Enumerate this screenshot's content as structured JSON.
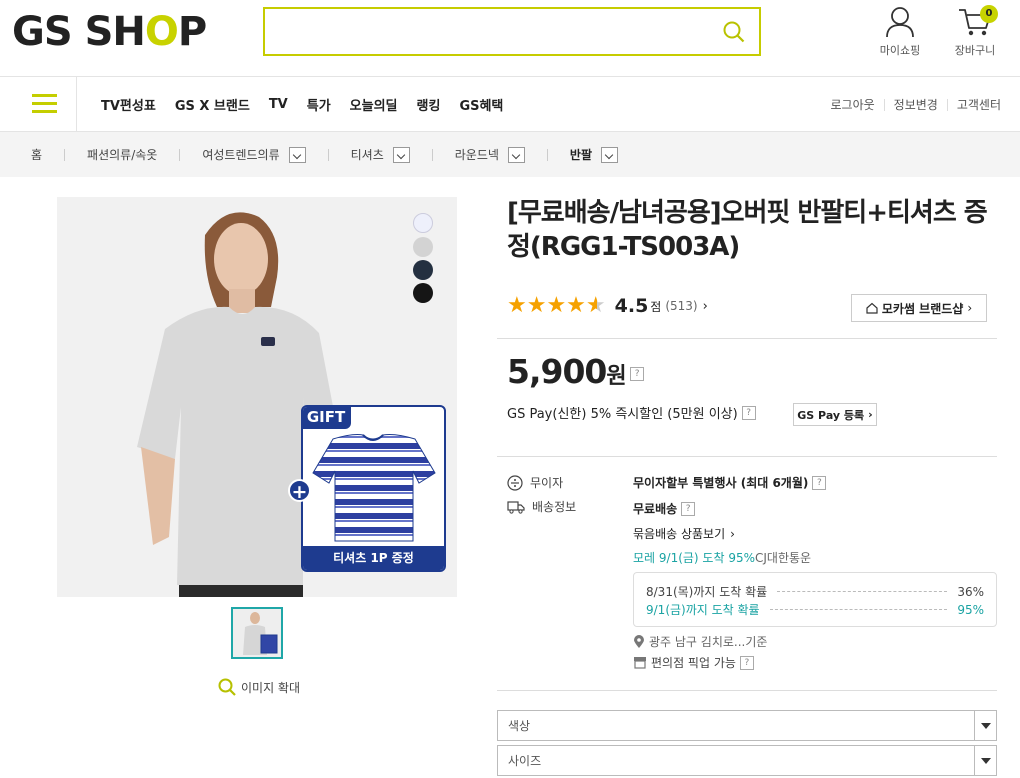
{
  "header": {
    "logo": "GS SHOP",
    "mypage_label": "마이쇼핑",
    "cart_label": "장바구니",
    "cart_count": "0"
  },
  "nav": {
    "items": [
      "TV편성표",
      "GS X 브랜드",
      "TV",
      "특가",
      "오늘의딜",
      "랭킹",
      "GS혜택"
    ],
    "right": [
      "로그아웃",
      "정보변경",
      "고객센터"
    ]
  },
  "breadcrumb": {
    "home": "홈",
    "items": [
      "패션의류/속옷",
      "여성트렌드의류",
      "티셔츠",
      "라운드넥",
      "반팔"
    ]
  },
  "product": {
    "title": "[무료배송/남녀공용]오버핏 반팔티+티셔츠 증정(RGG1-TS003A)",
    "rating": "4.5",
    "rating_unit": "점",
    "review_count": "(513)",
    "brand_button": "모카썸 브랜드샵",
    "price": "5,900",
    "price_unit": "원",
    "gspay_text": "GS Pay(신한) 5% 즉시할인 (5만원 이상)",
    "gspay_button": "GS Pay 등록",
    "gift_tag": "GIFT",
    "gift_text": "티셔츠 1P 증정",
    "zoom_label": "이미지 확대",
    "swatches": [
      "#eef0fb",
      "#d3d3d3",
      "#243040",
      "#151515"
    ]
  },
  "info": {
    "installment_label": "무이자",
    "installment_value": "무이자할부 특별행사 (최대 6개월)",
    "shipping_label": "배송정보",
    "shipping_value": "무료배송",
    "bundle_value": "묶음배송 상품보기",
    "arrival_teal": "모레 9/1(금) 도착 95%",
    "arrival_carrier": " CJ대한통운",
    "prob": [
      {
        "label": "8/31(목)까지 도착 확률",
        "value": "36%"
      },
      {
        "label": "9/1(금)까지 도착 확률",
        "value": "95%"
      }
    ],
    "location": "광주 남구 김치로...기준",
    "pickup": "편의점 픽업 가능"
  },
  "options": {
    "color_label": "색상",
    "size_label": "사이즈"
  }
}
